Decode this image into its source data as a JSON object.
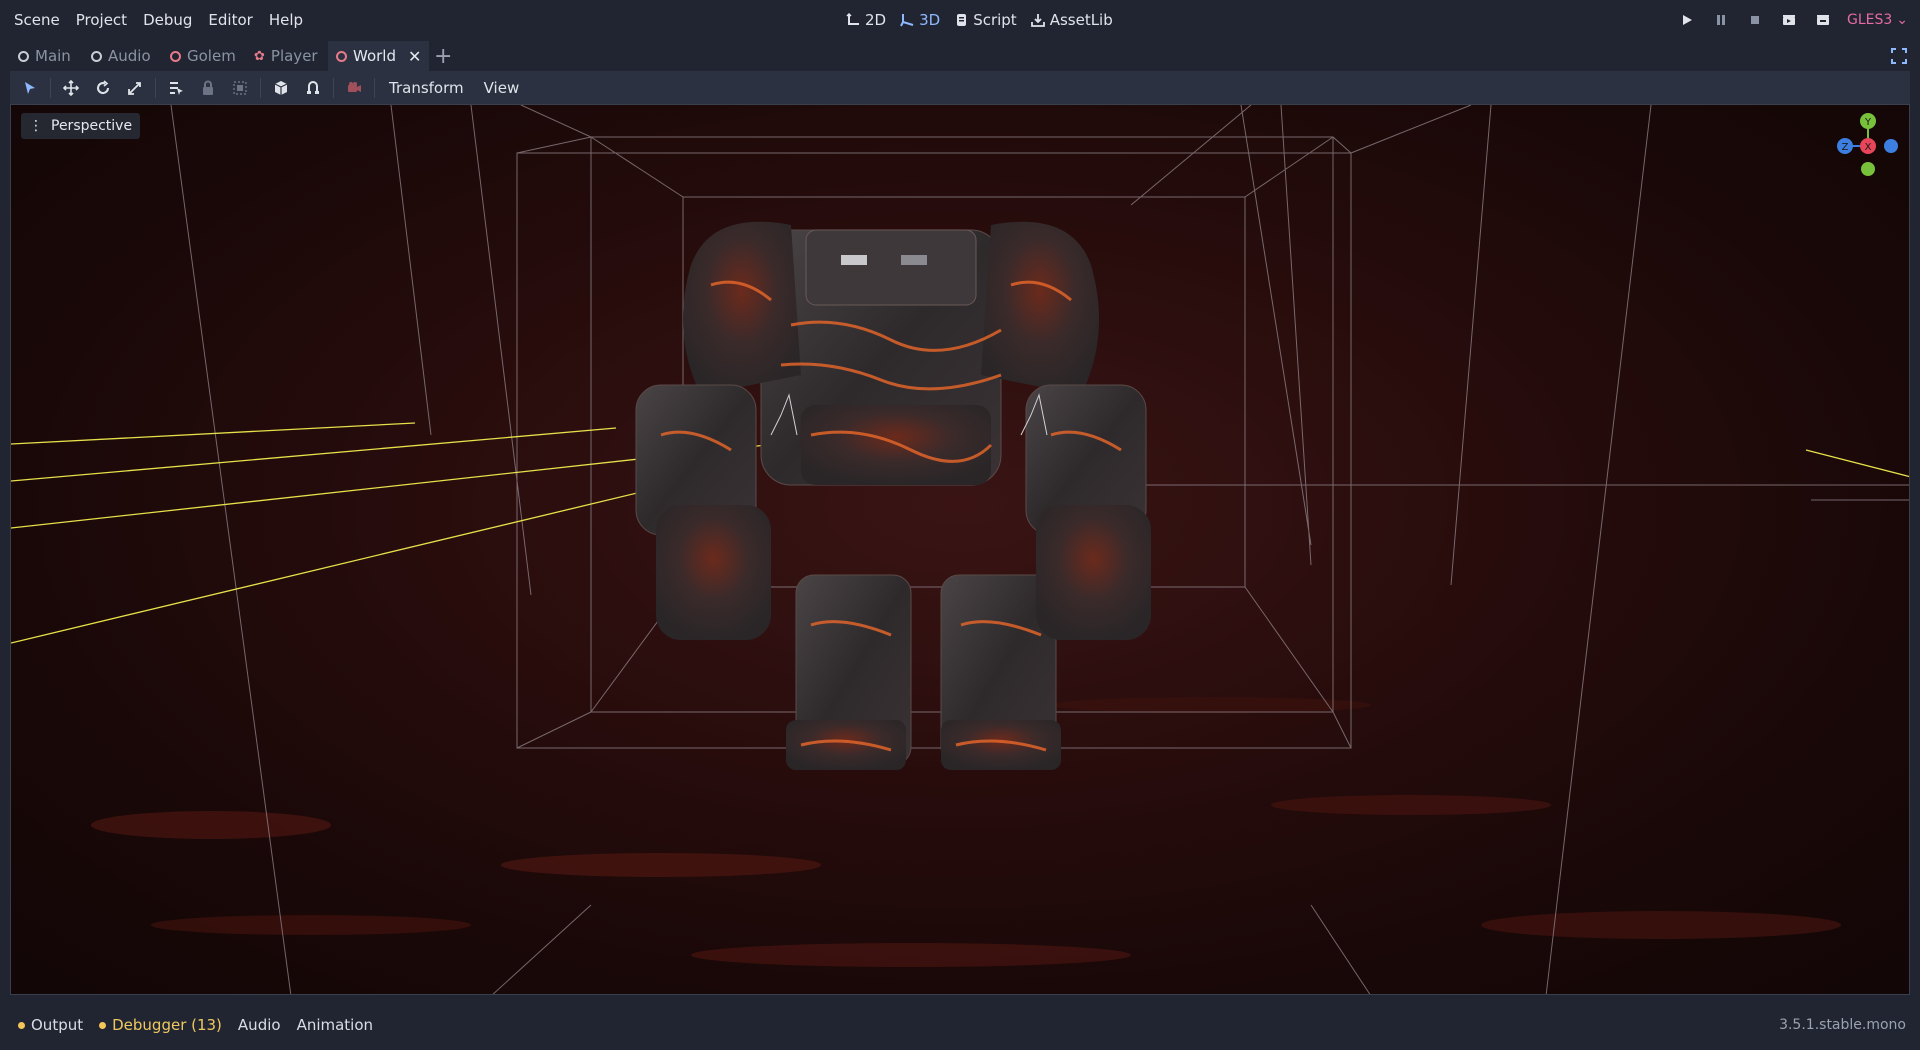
{
  "menu": {
    "items": [
      "Scene",
      "Project",
      "Debug",
      "Editor",
      "Help"
    ]
  },
  "workspaces": {
    "items": [
      {
        "label": "2D",
        "icon": "2d-workspace-icon"
      },
      {
        "label": "3D",
        "icon": "3d-workspace-icon"
      },
      {
        "label": "Script",
        "icon": "script-icon"
      },
      {
        "label": "AssetLib",
        "icon": "assetlib-icon"
      }
    ],
    "active": "3D"
  },
  "run_controls": {
    "renderer": "GLES3"
  },
  "tabs": {
    "items": [
      {
        "label": "Main",
        "icon": "node-ring-icon"
      },
      {
        "label": "Audio",
        "icon": "node-ring-icon"
      },
      {
        "label": "Golem",
        "icon": "node-ring-red-icon"
      },
      {
        "label": "Player",
        "icon": "character-icon"
      },
      {
        "label": "World",
        "icon": "node-ring-red-icon"
      }
    ],
    "active": "World",
    "add_label": "+"
  },
  "toolbar": {
    "transform_label": "Transform",
    "view_label": "View"
  },
  "viewport": {
    "perspective_label": "Perspective",
    "gizmo": {
      "y": "Y",
      "z": "Z",
      "x": "X"
    }
  },
  "bottom": {
    "output_label": "Output",
    "debugger_label": "Debugger (13)",
    "audio_label": "Audio",
    "animation_label": "Animation",
    "version": "3.5.1.stable.mono"
  },
  "colors": {
    "accent": "#8fb9ff",
    "renderer": "#e66aa3",
    "warning": "#f0c860",
    "gizmo_x": "#e8455a",
    "gizmo_y": "#77c23a",
    "gizmo_z": "#3d7fe0"
  }
}
